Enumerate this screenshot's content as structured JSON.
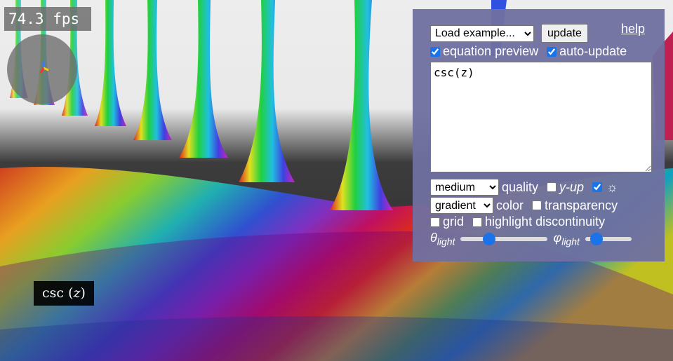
{
  "fps": {
    "text": "74.3 fps"
  },
  "equation_label": {
    "fn": "csc",
    "arg": "z"
  },
  "panel": {
    "example_select": {
      "selected": "Load example..."
    },
    "update_label": "update",
    "help_label": "help",
    "equation_preview": {
      "label": "equation preview",
      "checked": true
    },
    "auto_update": {
      "label": "auto-update",
      "checked": true
    },
    "equation_text": "csc(z)",
    "quality": {
      "selected": "medium",
      "label": "quality"
    },
    "y_up": {
      "label": "y-up",
      "checked": false
    },
    "light_toggle": {
      "checked": true,
      "icon": "sun-icon"
    },
    "color": {
      "selected": "gradient",
      "label": "color"
    },
    "transparency": {
      "label": "transparency",
      "checked": false
    },
    "grid": {
      "label": "grid",
      "checked": false
    },
    "highlight": {
      "label": "highlight discontinuity",
      "checked": false
    },
    "theta": {
      "symbol": "θ",
      "sub": "light",
      "value": 0.3
    },
    "phi": {
      "symbol": "φ",
      "sub": "light",
      "value": 0.15
    }
  },
  "colors": {
    "panel": "#7070a0",
    "accent": "#1a73e8"
  }
}
